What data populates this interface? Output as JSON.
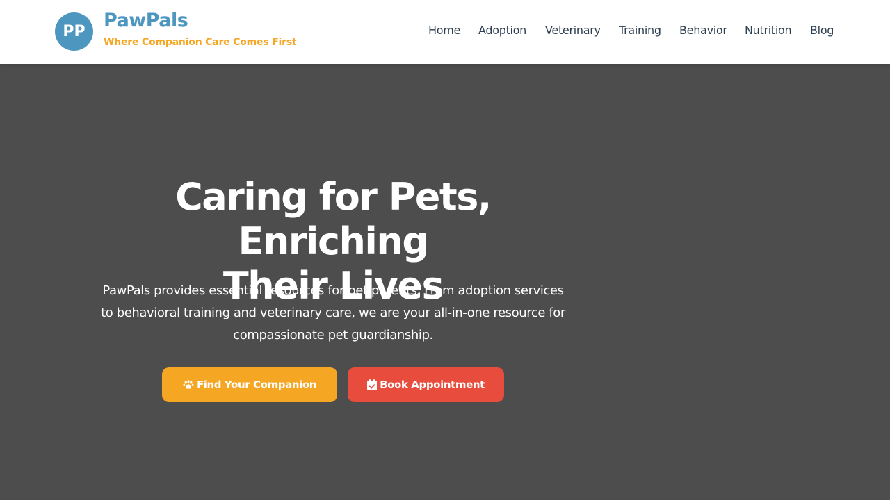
{
  "brand": {
    "logo_initials": "PP",
    "name": "PawPals",
    "tagline": "Where Companion Care Comes First"
  },
  "nav": {
    "items": [
      {
        "label": "Home"
      },
      {
        "label": "Adoption"
      },
      {
        "label": "Veterinary"
      },
      {
        "label": "Training"
      },
      {
        "label": "Behavior"
      },
      {
        "label": "Nutrition"
      },
      {
        "label": "Blog"
      }
    ]
  },
  "hero": {
    "title_line1": "Caring for Pets, Enriching",
    "title_line2": "Their Lives",
    "text_line1": "PawPals provides essential resources for pet parents. From adoption services",
    "text_line2": "to behavioral training and veterinary care, we are your all-in-one resource for",
    "text_line3": "compassionate pet guardianship.",
    "primary_button": {
      "label": "Find Your Companion",
      "icon": "paw-icon"
    },
    "secondary_button": {
      "label": "Book Appointment",
      "icon": "calendar-check-icon"
    }
  },
  "colors": {
    "brand_blue": "#4d96bf",
    "accent_orange": "#f5a623",
    "accent_red": "#e74c3c",
    "hero_background": "#4d4d4d",
    "nav_text": "#2c3e50"
  }
}
